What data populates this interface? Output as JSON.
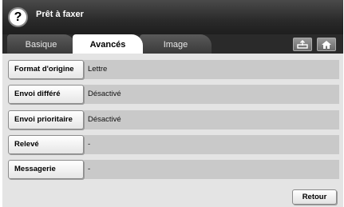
{
  "header": {
    "title": "Prêt à faxer",
    "help_glyph": "?"
  },
  "tabs": [
    {
      "label": "Basique",
      "active": false
    },
    {
      "label": "Avancés",
      "active": true
    },
    {
      "label": "Image",
      "active": false
    }
  ],
  "toolbar": {
    "send_icon": "tray-arrow-icon",
    "home_icon": "home-icon"
  },
  "options": [
    {
      "label": "Format d'origine",
      "value": "Lettre"
    },
    {
      "label": "Envoi différé",
      "value": "Désactivé"
    },
    {
      "label": "Envoi prioritaire",
      "value": "Désactivé"
    },
    {
      "label": "Relevé",
      "value": "-"
    },
    {
      "label": "Messagerie",
      "value": "-"
    }
  ],
  "footer": {
    "back_label": "Retour"
  }
}
